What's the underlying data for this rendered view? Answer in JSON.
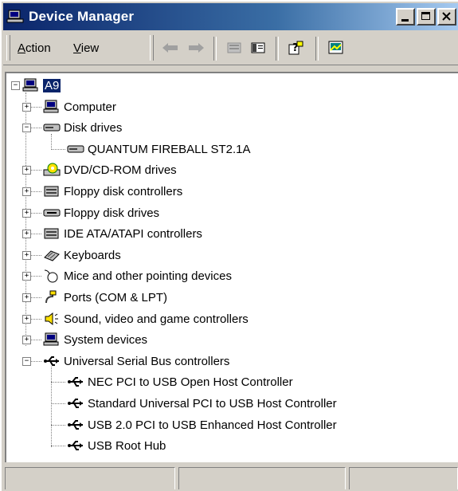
{
  "window": {
    "title": "Device Manager",
    "icon": "device-manager-icon"
  },
  "menu": {
    "action": "Action",
    "action_ul": "A",
    "action_rest": "ction",
    "view": "View",
    "view_ul": "V",
    "view_rest": "iew"
  },
  "toolbar": {
    "buttons": [
      "back-arrow-icon",
      "forward-arrow-icon",
      "up-level-icon",
      "show-hide-tree-icon",
      "help-icon",
      "properties-icon"
    ]
  },
  "tree": {
    "root": "A9",
    "items": [
      {
        "label": "Computer",
        "icon": "computer-icon",
        "expanded": false
      },
      {
        "label": "Disk drives",
        "icon": "disk-drive-icon",
        "expanded": true,
        "children": [
          "QUANTUM FIREBALL ST2.1A"
        ]
      },
      {
        "label": "DVD/CD-ROM drives",
        "icon": "cdrom-icon",
        "expanded": false
      },
      {
        "label": "Floppy disk controllers",
        "icon": "controller-icon",
        "expanded": false
      },
      {
        "label": "Floppy disk drives",
        "icon": "floppy-drive-icon",
        "expanded": false
      },
      {
        "label": "IDE ATA/ATAPI controllers",
        "icon": "controller-icon",
        "expanded": false
      },
      {
        "label": "Keyboards",
        "icon": "keyboard-icon",
        "expanded": false
      },
      {
        "label": "Mice and other pointing devices",
        "icon": "mouse-icon",
        "expanded": false
      },
      {
        "label": "Ports (COM & LPT)",
        "icon": "port-icon",
        "expanded": false
      },
      {
        "label": "Sound, video and game controllers",
        "icon": "speaker-icon",
        "expanded": false
      },
      {
        "label": "System devices",
        "icon": "computer-icon",
        "expanded": false
      },
      {
        "label": "Universal Serial Bus controllers",
        "icon": "usb-icon",
        "expanded": true,
        "children": [
          "NEC PCI to USB Open Host Controller",
          "Standard Universal PCI to USB Host Controller",
          "USB 2.0 PCI to USB Enhanced Host Controller",
          "USB Root Hub"
        ]
      }
    ]
  },
  "colors": {
    "title_start": "#0a246a",
    "title_end": "#a6caf0",
    "face": "#d4d0c8",
    "selection": "#0a246a"
  }
}
